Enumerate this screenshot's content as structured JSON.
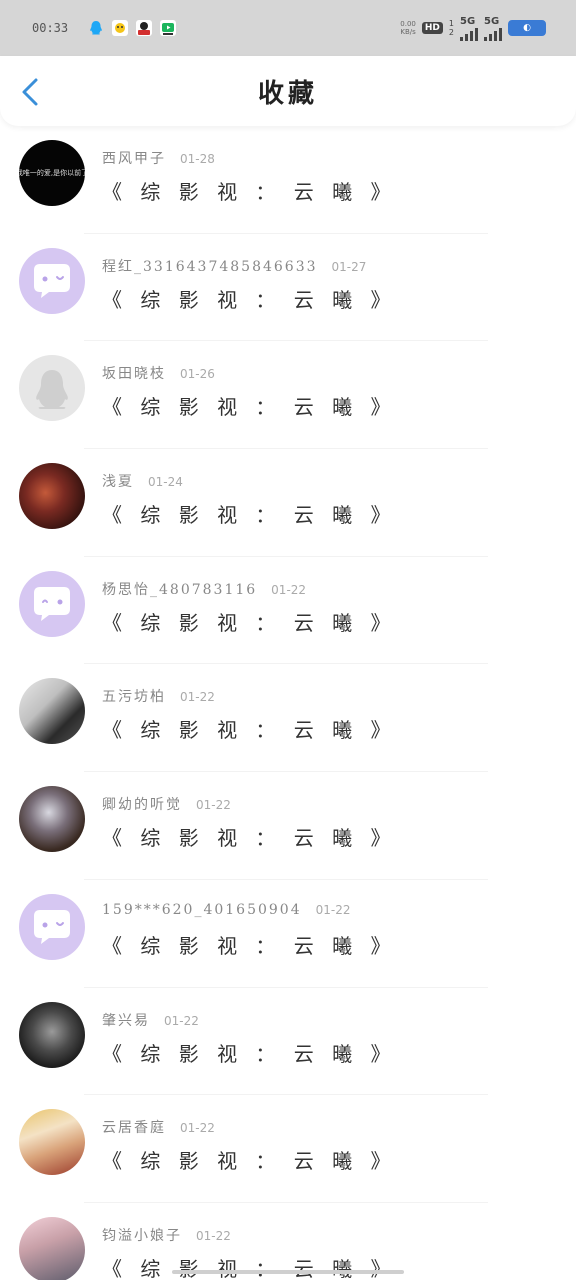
{
  "status_bar": {
    "time": "00:33",
    "network_speed_value": "0.00",
    "network_speed_unit": "KB/s",
    "hd_label": "HD",
    "sim1": "1",
    "sim2": "2",
    "net1": "5G",
    "net2": "5G",
    "battery_label": "◐"
  },
  "header": {
    "title": "收藏"
  },
  "items": [
    {
      "username": "西风甲子",
      "date": "01-28",
      "title": "《 综 影 视 ： 云 曦 》",
      "avatar_text": "我唯一的爱,是你以前了"
    },
    {
      "username": "程红_3316437485846633",
      "date": "01-27",
      "title": "《 综 影 视 ： 云 曦 》"
    },
    {
      "username": "坂田晓枝",
      "date": "01-26",
      "title": "《 综 影 视 ： 云 曦 》"
    },
    {
      "username": "浅夏",
      "date": "01-24",
      "title": "《 综 影 视 ： 云 曦 》"
    },
    {
      "username": "杨思怡_480783116",
      "date": "01-22",
      "title": "《 综 影 视 ： 云 曦 》"
    },
    {
      "username": "五污坊柏",
      "date": "01-22",
      "title": "《 综 影 视 ： 云 曦 》"
    },
    {
      "username": "卿幼的听觉",
      "date": "01-22",
      "title": "《 综 影 视 ： 云 曦 》"
    },
    {
      "username": "159***620_401650904",
      "date": "01-22",
      "title": "《 综 影 视 ： 云 曦 》"
    },
    {
      "username": "肇兴易",
      "date": "01-22",
      "title": "《 综 影 视 ： 云 曦 》"
    },
    {
      "username": "云居香庭",
      "date": "01-22",
      "title": "《 综 影 视 ： 云 曦 》"
    },
    {
      "username": "钧溢小娘子",
      "date": "01-22",
      "title": "《 综 影 视 ： 云 曦 》"
    }
  ],
  "colors": {
    "accent": "#3a8fd9",
    "default_avatar_bg": "#d6c7f2"
  }
}
